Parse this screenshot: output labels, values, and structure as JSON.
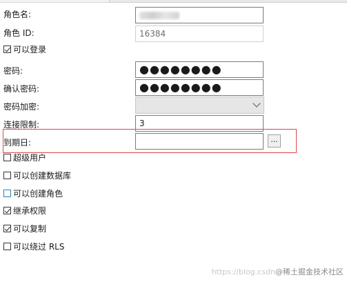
{
  "form": {
    "role_name_label": "角色名:",
    "role_id_label": "角色 ID:",
    "role_id_value": "16384",
    "can_login_label": "可以登录",
    "password_label": "密码:",
    "password_value": "●●●●●●●●",
    "confirm_password_label": "确认密码:",
    "confirm_password_value": "●●●●●●●●",
    "password_encryption_label": "密码加密:",
    "password_encryption_value": "",
    "connection_limit_label": "连接限制:",
    "connection_limit_value": "3",
    "expiry_date_label": "到期日:",
    "expiry_date_value": "",
    "browse_button_label": "..."
  },
  "options": [
    {
      "label": "超级用户",
      "checked": false
    },
    {
      "label": "可以创建数据库",
      "checked": false
    },
    {
      "label": "可以创建角色",
      "checked": false
    },
    {
      "label": "继承权限",
      "checked": true
    },
    {
      "label": "可以复制",
      "checked": true
    },
    {
      "label": "可以绕过 RLS",
      "checked": false
    }
  ],
  "watermark": {
    "url_text": "https://blog.csdn",
    "site_text": "@稀土掘金技术社区"
  },
  "colors": {
    "highlight_border": "#d9484b",
    "focused_checkbox": "#2f7fb5"
  }
}
